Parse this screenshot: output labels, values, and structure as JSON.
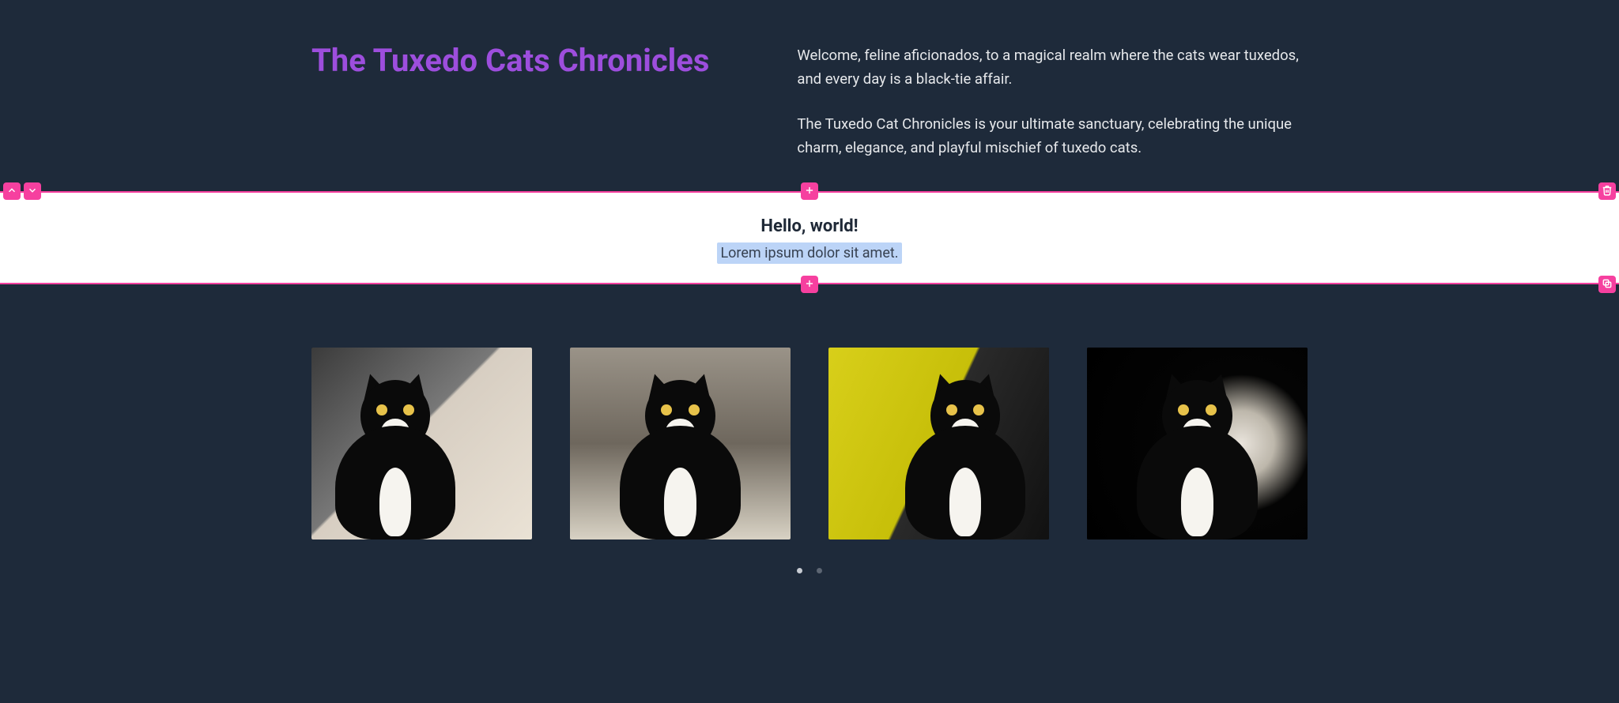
{
  "hero": {
    "title": "The Tuxedo Cats Chronicles",
    "para1": "Welcome, feline aficionados, to a magical realm where the cats wear tuxedos, and every day is a black-tie affair.",
    "para2": "The Tuxedo Cat Chronicles is your ultimate sanctuary, celebrating the unique charm, elegance, and playful mischief of tuxedo cats."
  },
  "editor_block": {
    "title": "Hello, world!",
    "subtitle": "Lorem ipsum dolor sit amet."
  },
  "editor_controls": {
    "move_up": "move-up",
    "move_down": "move-down",
    "add_top": "add",
    "delete": "delete",
    "add_bottom": "add",
    "duplicate": "duplicate"
  },
  "gallery": {
    "items": [
      {
        "alt": "Tuxedo cat close-up on light floor"
      },
      {
        "alt": "Tuxedo cat sitting in sunlight indoors"
      },
      {
        "alt": "Tuxedo cat on yellow chair looking back"
      },
      {
        "alt": "Tuxedo cat portrait dark background"
      }
    ]
  },
  "pager": {
    "active_index": 0,
    "count": 2
  }
}
